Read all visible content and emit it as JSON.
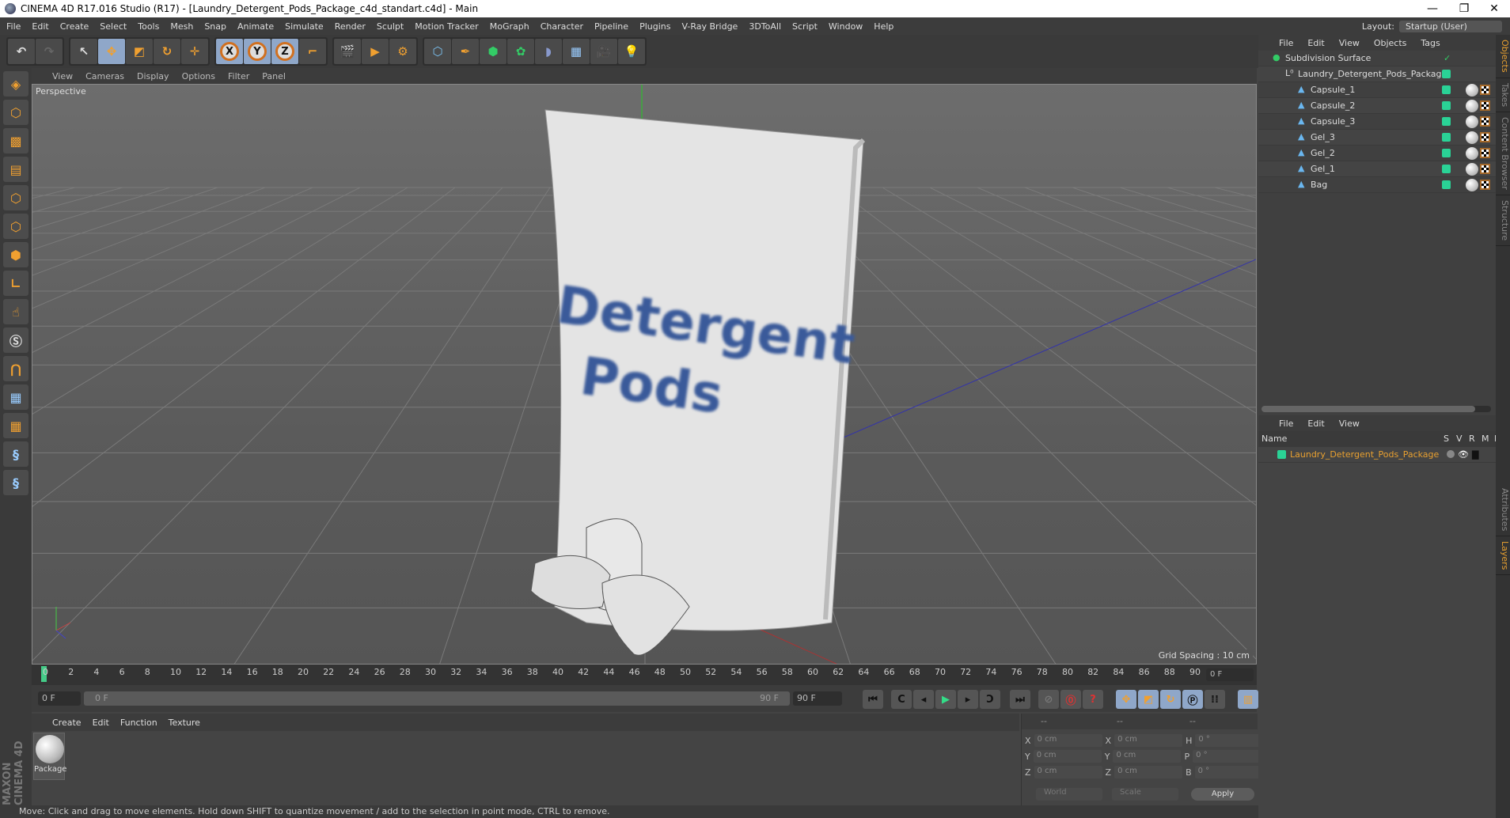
{
  "window": {
    "title": "CINEMA 4D R17.016 Studio (R17) - [Laundry_Detergent_Pods_Package_c4d_standart.c4d] - Main",
    "minimize": "—",
    "restore": "❐",
    "close": "✕"
  },
  "menu": [
    "File",
    "Edit",
    "Create",
    "Select",
    "Tools",
    "Mesh",
    "Snap",
    "Animate",
    "Simulate",
    "Render",
    "Sculpt",
    "Motion Tracker",
    "MoGraph",
    "Character",
    "Pipeline",
    "Plugins",
    "V-Ray Bridge",
    "3DToAll",
    "Script",
    "Window",
    "Help"
  ],
  "layout": {
    "label": "Layout:",
    "value": "Startup (User)"
  },
  "toolbar": {
    "axes": [
      "X",
      "Y",
      "Z"
    ]
  },
  "viewport": {
    "menu": [
      "View",
      "Cameras",
      "Display",
      "Options",
      "Filter",
      "Panel"
    ],
    "camera": "Perspective",
    "grid_spacing": "Grid Spacing : 10 cm",
    "bag_text": [
      "Detergent",
      "Pods"
    ]
  },
  "timeline": {
    "ticks": [
      "0",
      "2",
      "4",
      "6",
      "8",
      "10",
      "12",
      "14",
      "16",
      "18",
      "20",
      "22",
      "24",
      "26",
      "28",
      "30",
      "32",
      "34",
      "36",
      "38",
      "40",
      "42",
      "44",
      "46",
      "48",
      "50",
      "52",
      "54",
      "56",
      "58",
      "60",
      "62",
      "64",
      "66",
      "68",
      "70",
      "72",
      "74",
      "76",
      "78",
      "80",
      "82",
      "84",
      "86",
      "88",
      "90"
    ],
    "current": "0 F",
    "start": "0 F",
    "range_start": "0 F",
    "range_end": "90 F",
    "end": "90 F"
  },
  "materials": {
    "menu": [
      "Create",
      "Edit",
      "Function",
      "Texture"
    ],
    "items": [
      {
        "name": "Package"
      }
    ]
  },
  "coords": {
    "headers": [
      "--",
      "--",
      "--"
    ],
    "rows": [
      {
        "l1": "X",
        "v1": "0 cm",
        "l2": "X",
        "v2": "0 cm",
        "l3": "H",
        "v3": "0 °"
      },
      {
        "l1": "Y",
        "v1": "0 cm",
        "l2": "Y",
        "v2": "0 cm",
        "l3": "P",
        "v3": "0 °"
      },
      {
        "l1": "Z",
        "v1": "0 cm",
        "l2": "Z",
        "v2": "0 cm",
        "l3": "B",
        "v3": "0 °"
      }
    ],
    "space": "World",
    "mode": "Scale",
    "apply": "Apply"
  },
  "status": "Move: Click and drag to move elements. Hold down SHIFT to quantize movement / add to the selection in point mode, CTRL to remove.",
  "objects": {
    "menu": [
      "File",
      "Edit",
      "View",
      "Objects",
      "Tags"
    ],
    "tree": [
      {
        "name": "Subdivision Surface",
        "depth": 0
      },
      {
        "name": "Laundry_Detergent_Pods_Package",
        "depth": 1
      },
      {
        "name": "Capsule_1",
        "depth": 2
      },
      {
        "name": "Capsule_2",
        "depth": 2
      },
      {
        "name": "Capsule_3",
        "depth": 2
      },
      {
        "name": "Gel_3",
        "depth": 2
      },
      {
        "name": "Gel_2",
        "depth": 2
      },
      {
        "name": "Gel_1",
        "depth": 2
      },
      {
        "name": "Bag",
        "depth": 2
      }
    ]
  },
  "layers": {
    "menu": [
      "File",
      "Edit",
      "View"
    ],
    "columns": [
      "Name",
      "S",
      "V",
      "R",
      "M",
      "L"
    ],
    "rows": [
      {
        "name": "Laundry_Detergent_Pods_Package",
        "color": "#2ad296"
      }
    ]
  },
  "side_tabs": [
    "Objects",
    "Takes",
    "Content Browser",
    "Structure",
    "Attributes",
    "Layers"
  ],
  "brand": "MAXON CINEMA 4D",
  "colors": {
    "accent": "#f0a030",
    "layer_green": "#2ad296",
    "selected_text": "#e8a030"
  }
}
